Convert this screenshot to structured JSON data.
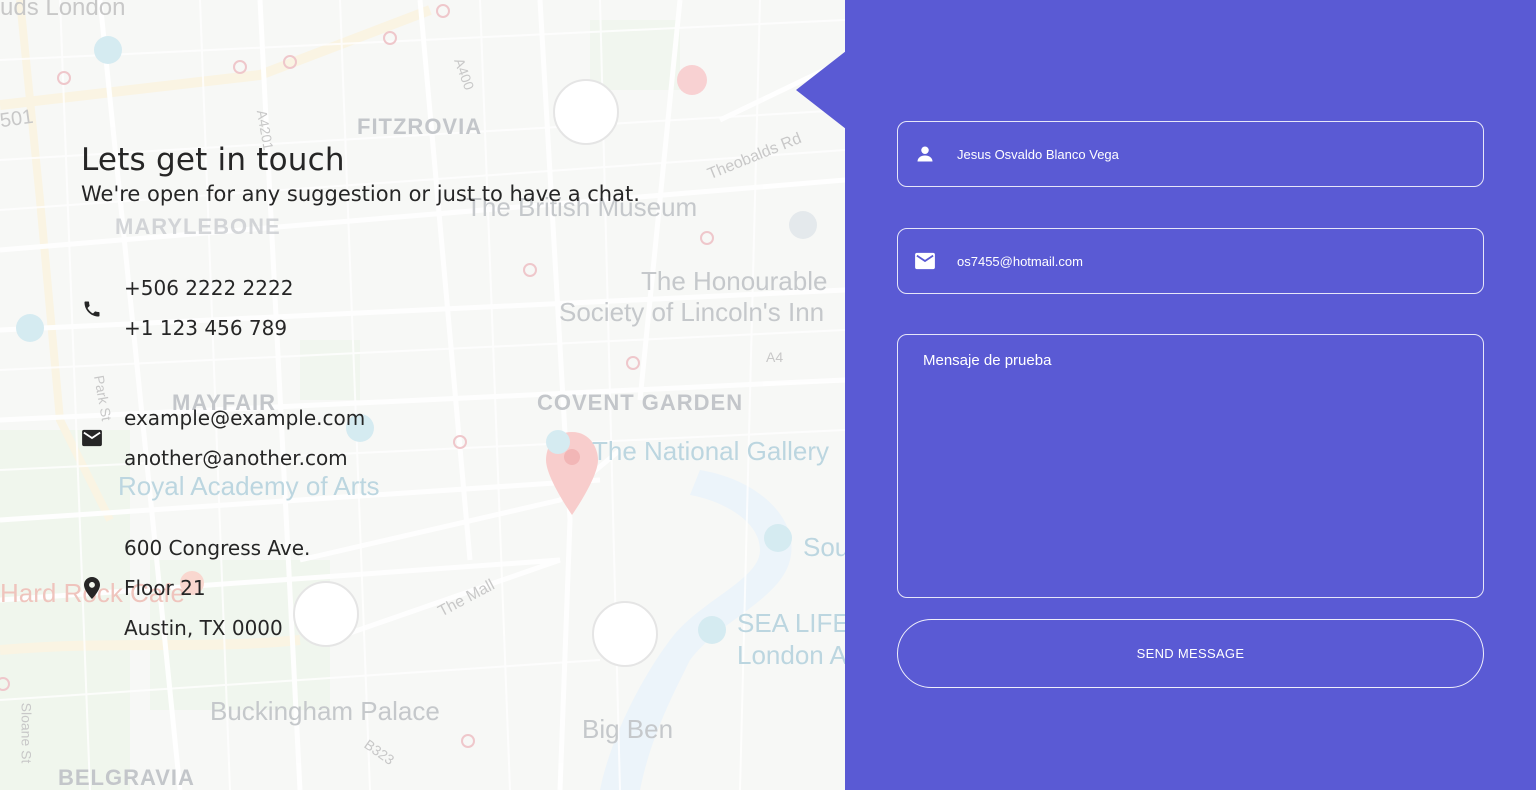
{
  "map": {
    "labels": {
      "fitzrovia": "FITZROVIA",
      "marylebone": "MARYLEBONE",
      "british_museum": "The British Museum",
      "lincolns_inn_1": "The Honourable",
      "lincolns_inn_2": "Society of Lincoln's Inn",
      "covent_garden": "COVENT GARDEN",
      "mayfair": "MAYFAIR",
      "national_gallery": "The National Gallery",
      "royal_academy": "Royal Academy of Arts",
      "hard_rock": "Hard Rock Cafe",
      "the_mall": "The Mall",
      "sea_life_1": "SEA LIFE",
      "sea_life_2": "London A",
      "south": "Sou",
      "buckingham": "Buckingham Palace",
      "big_ben": "Big Ben",
      "belgravia": "BELGRAVIA",
      "sloane": "Sloane St",
      "london_top": "uds London",
      "theobalds": "Theobalds Rd",
      "a400": "A400",
      "a4201": "A4201",
      "a4": "A4",
      "b323": "B323",
      "park_st": "Park St",
      "a501": "501"
    }
  },
  "contact": {
    "title": "Lets get in touch",
    "subtitle": "We're open for any suggestion or just to have a chat.",
    "phones": [
      "+506 2222 2222",
      "+1 123 456 789"
    ],
    "emails": [
      "example@example.com",
      "another@another.com"
    ],
    "address": [
      "600 Congress Ave.",
      "Floor 21",
      "Austin, TX 0000"
    ]
  },
  "form": {
    "name_value": "Jesus Osvaldo Blanco Vega",
    "email_value": "os7455@hotmail.com",
    "message_value": "Mensaje de prueba",
    "send_label": "SEND MESSAGE"
  },
  "colors": {
    "panel": "#5a5ad4",
    "text": "#262626",
    "map_pin": "#f4a0a0"
  },
  "icons": {
    "phone": "phone-icon",
    "email": "email-icon",
    "location": "location-pin-icon",
    "user": "user-icon"
  }
}
